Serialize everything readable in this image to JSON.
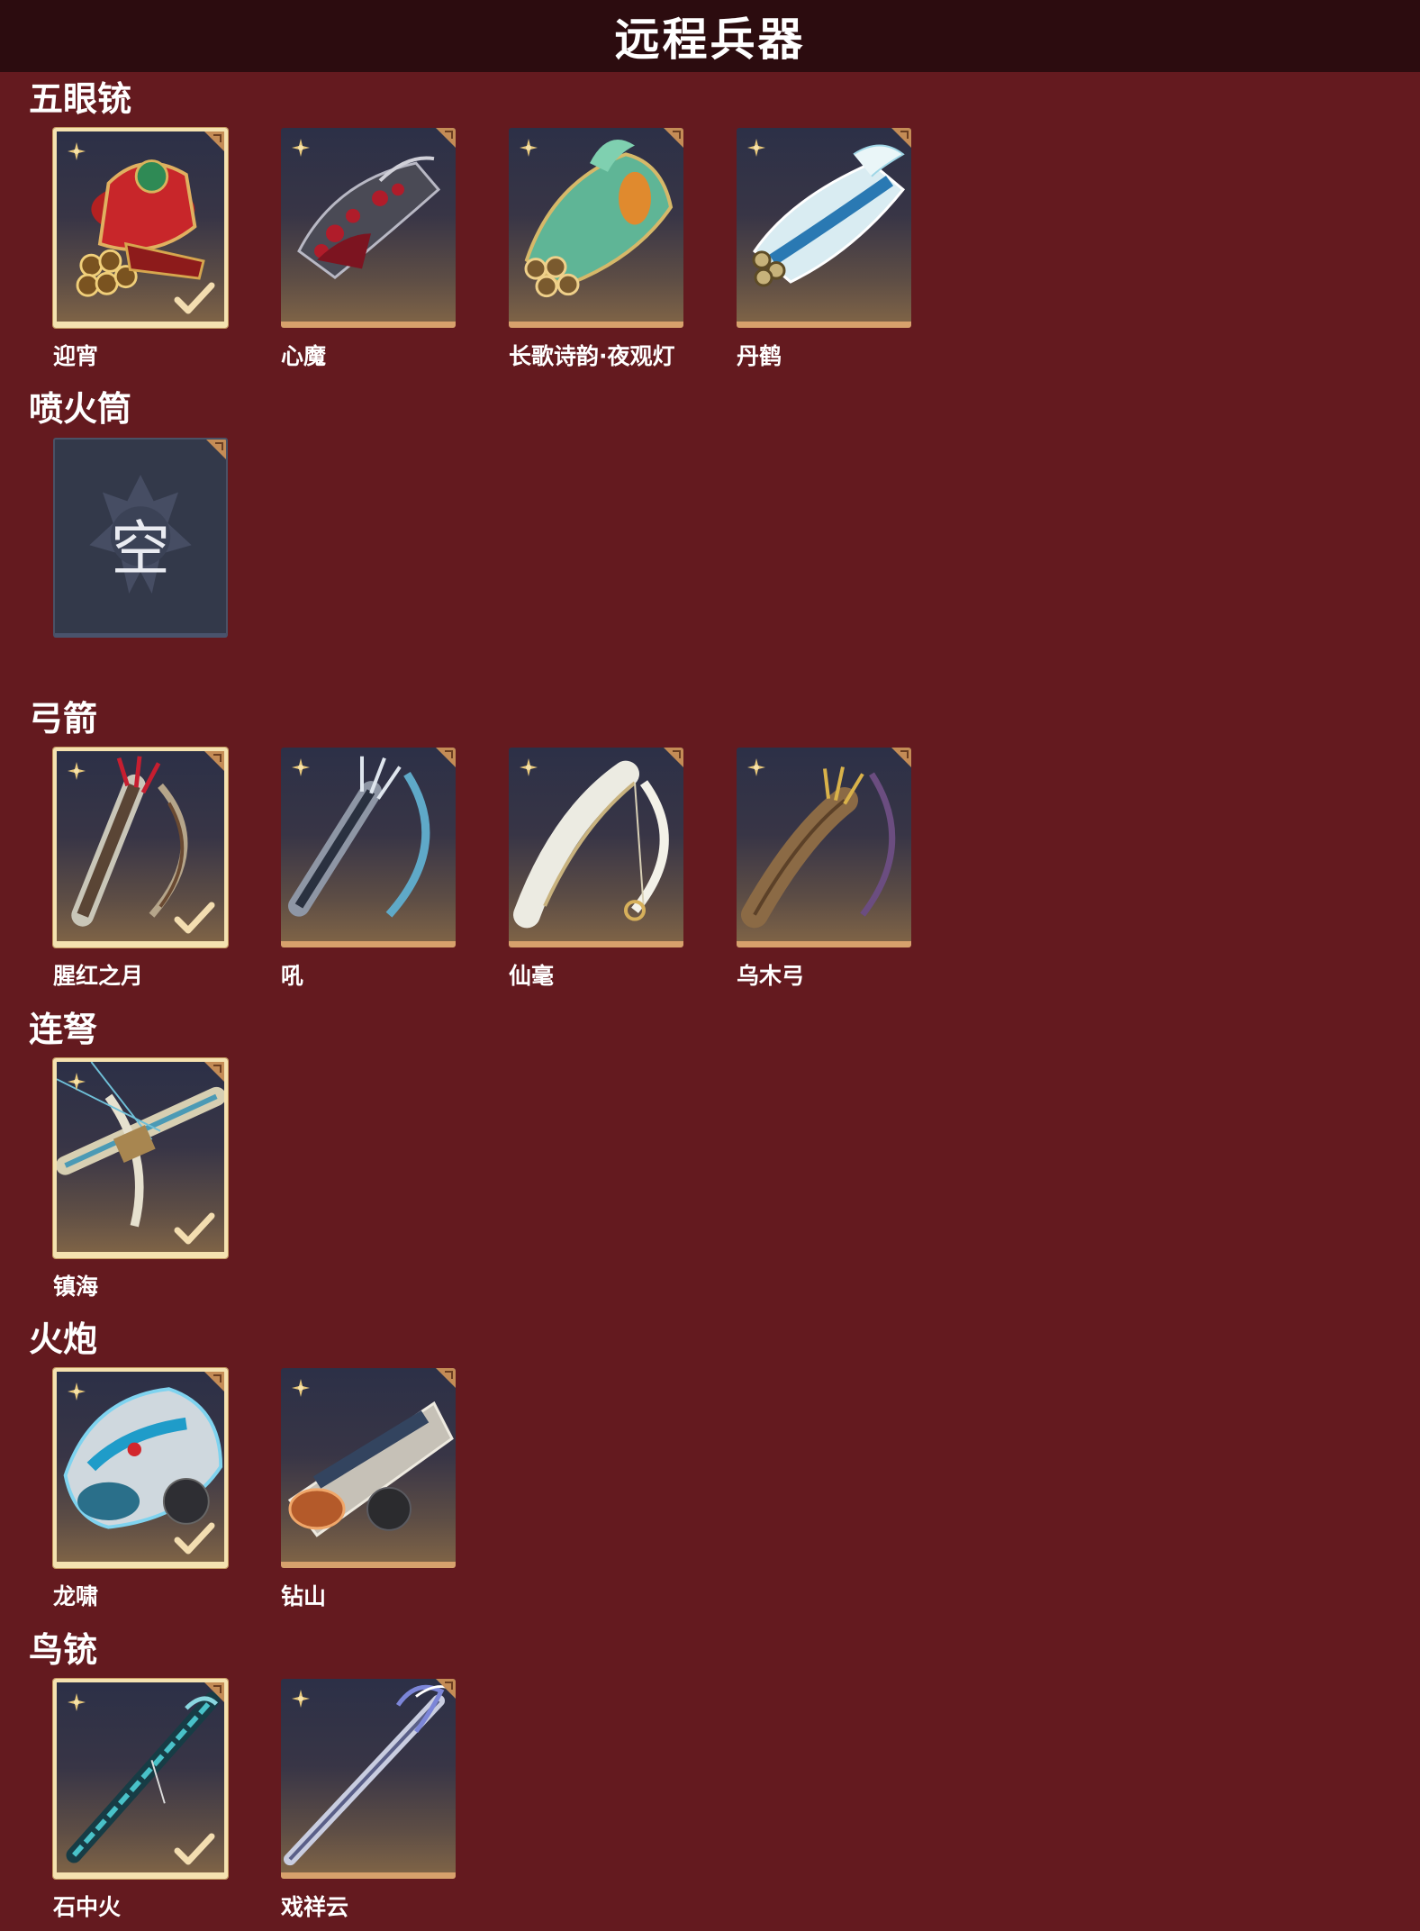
{
  "title": "远程兵器",
  "colors": {
    "background": "#641a1f",
    "header": "#2c0c0f",
    "card_frame": "#d7a16c",
    "selected_frame": "#f5e2b0",
    "empty_card": "#33394a"
  },
  "sections": [
    {
      "name": "五眼铳",
      "items": [
        {
          "name": "迎宵",
          "selected": true,
          "icon": "multi-barrel-gun-icon"
        },
        {
          "name": "心魔",
          "selected": false,
          "icon": "demon-gun-icon"
        },
        {
          "name": "长歌诗韵·夜观灯",
          "selected": false,
          "icon": "jade-gun-icon"
        },
        {
          "name": "丹鹤",
          "selected": false,
          "icon": "crane-gun-icon"
        }
      ]
    },
    {
      "name": "喷火筒",
      "items": [
        {
          "name": "",
          "empty": true,
          "empty_text": "空",
          "icon": "empty-slot-icon"
        }
      ]
    },
    {
      "name": "弓箭",
      "items": [
        {
          "name": "腥红之月",
          "selected": true,
          "icon": "crimson-bow-icon"
        },
        {
          "name": "吼",
          "selected": false,
          "icon": "silver-bow-icon"
        },
        {
          "name": "仙毫",
          "selected": false,
          "icon": "white-bow-icon"
        },
        {
          "name": "乌木弓",
          "selected": false,
          "icon": "ebony-bow-icon"
        }
      ]
    },
    {
      "name": "连弩",
      "items": [
        {
          "name": "镇海",
          "selected": true,
          "icon": "crossbow-icon"
        }
      ]
    },
    {
      "name": "火炮",
      "items": [
        {
          "name": "龙啸",
          "selected": true,
          "icon": "dragon-cannon-icon"
        },
        {
          "name": "钻山",
          "selected": false,
          "icon": "drill-cannon-icon"
        }
      ]
    },
    {
      "name": "鸟铳",
      "items": [
        {
          "name": "石中火",
          "selected": true,
          "icon": "teal-musket-icon"
        },
        {
          "name": "戏祥云",
          "selected": false,
          "icon": "silver-musket-icon"
        }
      ]
    }
  ]
}
